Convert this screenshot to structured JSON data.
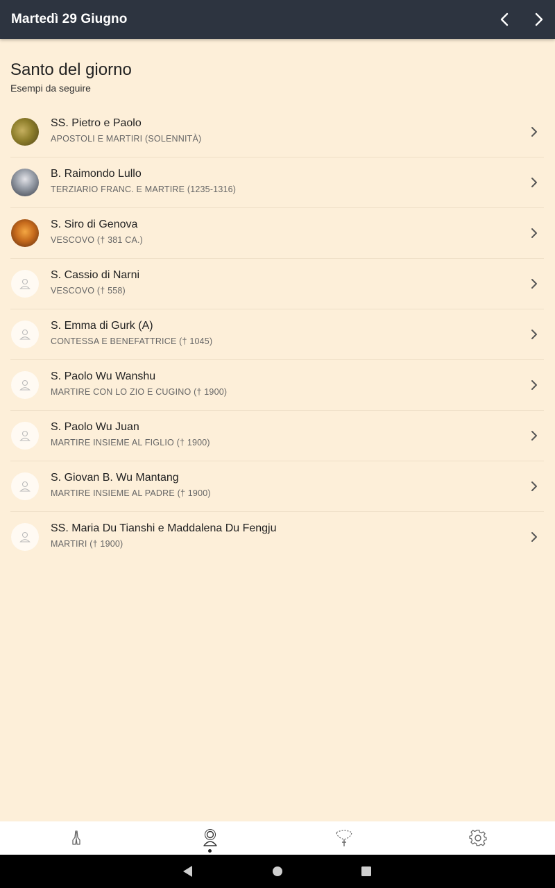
{
  "header": {
    "title": "Martedì 29 Giugno",
    "prev_icon": "chevron-left-icon",
    "next_icon": "chevron-right-icon",
    "background": "#2d3440"
  },
  "section": {
    "title": "Santo del giorno",
    "subtitle": "Esempi da seguire"
  },
  "saints": [
    {
      "name": "SS. Pietro e Paolo",
      "desc": "APOSTOLI E MARTIRI (SOLENNITÀ)",
      "avatar": "photo"
    },
    {
      "name": "B. Raimondo Lullo",
      "desc": "TERZIARIO FRANC. E MARTIRE (1235-1316)",
      "avatar": "photo"
    },
    {
      "name": "S. Siro di Genova",
      "desc": "VESCOVO († 381 CA.)",
      "avatar": "photo"
    },
    {
      "name": "S. Cassio di Narni",
      "desc": "VESCOVO († 558)",
      "avatar": "placeholder-person-icon"
    },
    {
      "name": "S. Emma di Gurk (A)",
      "desc": "CONTESSA E BENEFATTRICE († 1045)",
      "avatar": "placeholder-person-icon"
    },
    {
      "name": "S. Paolo Wu Wanshu",
      "desc": "MARTIRE CON LO ZIO E CUGINO († 1900)",
      "avatar": "placeholder-person-icon"
    },
    {
      "name": "S. Paolo Wu Juan",
      "desc": "MARTIRE INSIEME AL FIGLIO († 1900)",
      "avatar": "placeholder-person-icon"
    },
    {
      "name": "S. Giovan B. Wu Mantang",
      "desc": "MARTIRE INSIEME AL PADRE († 1900)",
      "avatar": "placeholder-person-icon"
    },
    {
      "name": "SS. Maria Du Tianshi e Maddalena Du Fengju",
      "desc": "MARTIRI († 1900)",
      "avatar": "placeholder-person-icon"
    }
  ],
  "bottom_nav": {
    "items": [
      {
        "icon": "praying-hands-icon",
        "active": false
      },
      {
        "icon": "saint-icon",
        "active": true
      },
      {
        "icon": "rosary-icon",
        "active": false
      },
      {
        "icon": "gear-icon",
        "active": false
      }
    ]
  },
  "system_nav": {
    "back_icon": "back-triangle-icon",
    "home_icon": "home-circle-icon",
    "recents_icon": "recents-square-icon"
  }
}
